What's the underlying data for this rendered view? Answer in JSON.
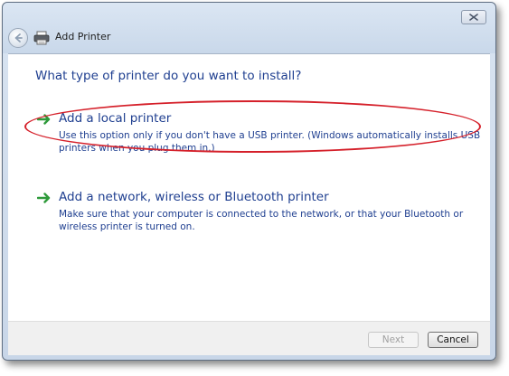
{
  "window": {
    "title": "Add Printer"
  },
  "main": {
    "heading": "What type of printer do you want to install?",
    "options": [
      {
        "title": "Add a local printer",
        "description": "Use this option only if you don't have a USB printer. (Windows automatically installs USB printers when you plug them in.)",
        "highlighted": true
      },
      {
        "title": "Add a network, wireless or Bluetooth printer",
        "description": "Make sure that your computer is connected to the network, or that your Bluetooth or wireless printer is turned on.",
        "highlighted": false
      }
    ]
  },
  "footer": {
    "next_label": "Next",
    "next_enabled": false,
    "cancel_label": "Cancel"
  },
  "colors": {
    "link_text": "#1f3f90",
    "arrow": "#2e9a3a",
    "highlight": "#d5202a"
  },
  "icons": {
    "back": "back-arrow-icon",
    "printer": "printer-icon",
    "close": "close-icon",
    "option": "green-arrow-icon"
  }
}
